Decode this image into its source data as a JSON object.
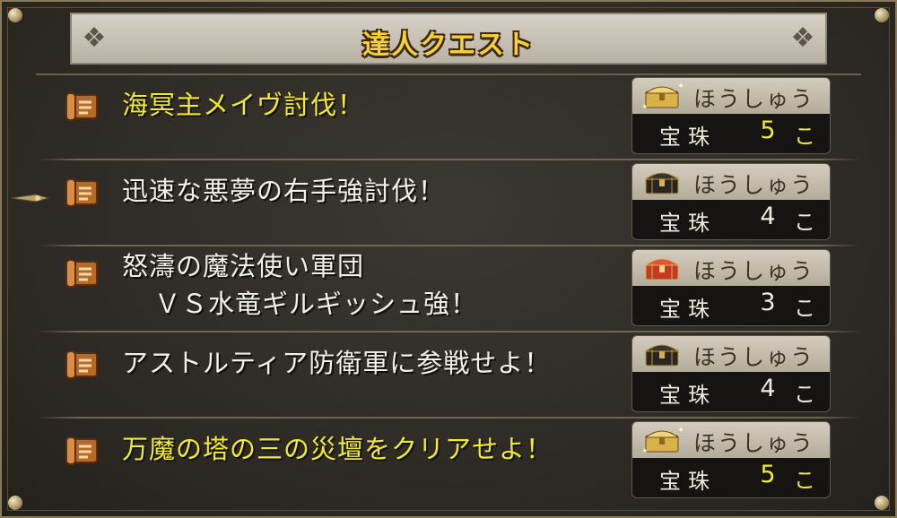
{
  "title": "達人クエスト",
  "reward_label": "ほうしゅう",
  "quests": [
    {
      "name_line1": "海冥主メイヴ討伐！",
      "name_line2": "",
      "highlight": true,
      "chest": "gold-chest-icon",
      "item": "宝珠",
      "qty": "5",
      "unit": "こ"
    },
    {
      "name_line1": "迅速な悪夢の右手強討伐！",
      "name_line2": "",
      "highlight": false,
      "chest": "black-chest-icon",
      "item": "宝珠",
      "qty": "4",
      "unit": "こ"
    },
    {
      "name_line1": "怒濤の魔法使い軍団",
      "name_line2": "ＶＳ水竜ギルギッシュ強！",
      "highlight": false,
      "chest": "red-chest-icon",
      "item": "宝珠",
      "qty": "3",
      "unit": "こ"
    },
    {
      "name_line1": "アストルティア防衛軍に参戦せよ！",
      "name_line2": "",
      "highlight": false,
      "chest": "black-chest-icon",
      "item": "宝珠",
      "qty": "4",
      "unit": "こ"
    },
    {
      "name_line1": "万魔の塔の三の災壇をクリアせよ！",
      "name_line2": "",
      "highlight": true,
      "chest": "gold-chest-icon",
      "item": "宝珠",
      "qty": "5",
      "unit": "こ"
    }
  ],
  "colors": {
    "highlight_text": "#f2ea2a",
    "normal_text": "#f1efe8",
    "title_text": "#f6cf3a"
  }
}
